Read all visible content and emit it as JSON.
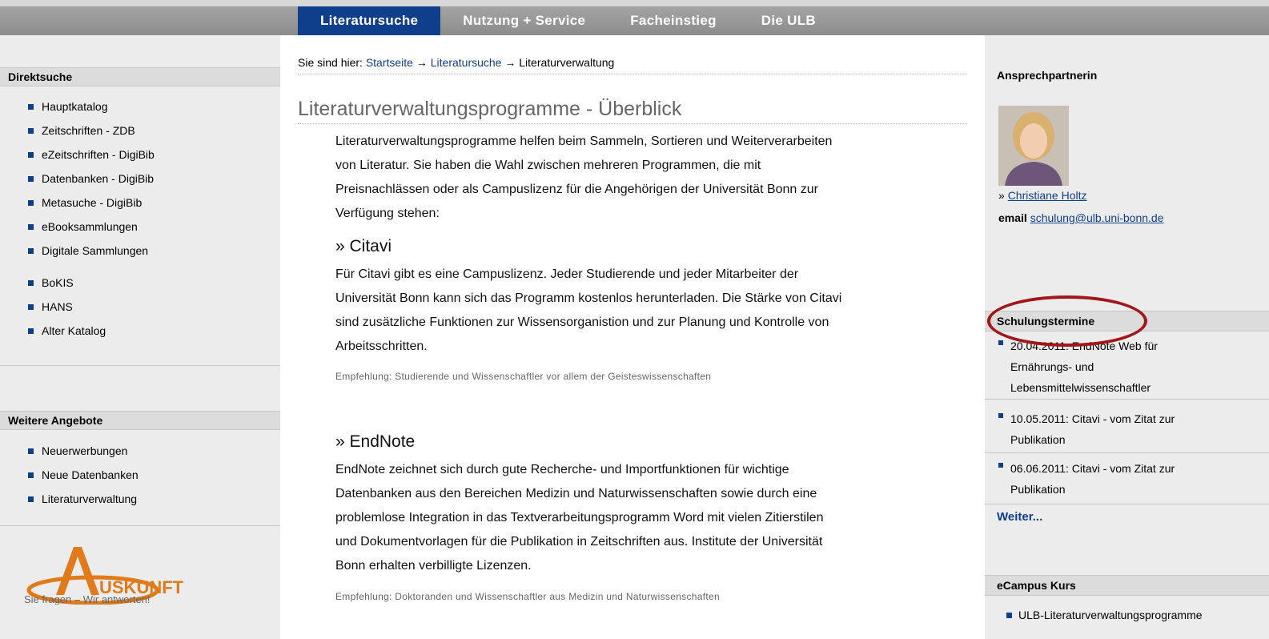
{
  "nav": {
    "items": [
      "Literatursuche",
      "Nutzung + Service",
      "Facheinstieg",
      "Die ULB"
    ]
  },
  "left": {
    "direktsuche_title": "Direktsuche",
    "direktsuche_items": [
      "Hauptkatalog",
      "Zeitschriften - ZDB",
      "eZeitschriften - DigiBib",
      "Datenbanken - DigiBib",
      "Metasuche - DigiBib",
      "eBooksammlungen",
      "Digitale Sammlungen"
    ],
    "other_items": [
      "BoKIS",
      "HANS",
      "Alter Katalog"
    ],
    "weitere_title": "Weitere Angebote",
    "weitere_items": [
      "Neuerwerbungen",
      "Neue Datenbanken",
      "Literaturverwaltung"
    ],
    "logo_text": "USKUNFT",
    "logo_tagline": "Sie fragen – Wir antworten!"
  },
  "breadcrumb": {
    "prefix": "Sie sind hier: ",
    "home": "Startseite",
    "arrow1": " → ",
    "section": "Literatursuche",
    "arrow2": " → ",
    "current": "Literaturverwaltung"
  },
  "main": {
    "title": "Literaturverwaltungsprogramme - Überblick",
    "intro": [
      "Literaturverwaltungsprogramme helfen beim Sammeln, Sortieren und Weiterverarbeiten",
      "von Literatur.  Sie haben die Wahl zwischen mehreren Programmen, die mit",
      "Preisnachlässen oder als Campuslizenz für die Angehörigen der Universität Bonn zur",
      "Verfügung stehen:"
    ],
    "citavi_heading": "» Citavi",
    "citavi_text": [
      "Für Citavi gibt es eine Campuslizenz. Jeder Studierende und jeder Mitarbeiter der",
      "Universität Bonn kann sich das Programm kostenlos herunterladen. Die Stärke von Citavi",
      "sind zusätzliche Funktionen zur Wissensorganistion und zur Planung und Kontrolle von",
      "Arbeitsschritten."
    ],
    "citavi_recommend": "Empfehlung: Studierende und Wissenschaftler vor allem der Geisteswissenschaften",
    "endnote_heading": "» EndNote",
    "endnote_text": [
      "EndNote zeichnet sich durch gute Recherche- und Importfunktionen für wichtige",
      "Datenbanken aus den Bereichen Medizin und Naturwissenschaften sowie durch eine",
      "problemlose Integration in das Textverarbeitungsprogramm Word mit vielen Zitierstilen",
      "und Dokumentvorlagen für die Publikation in Zeitschriften aus. Institute der Universität",
      "Bonn erhalten verbilligte Lizenzen."
    ],
    "endnote_recommend": "Empfehlung: Doktoranden und Wissenschaftler aus Medizin und Naturwissenschaften"
  },
  "right": {
    "contact_title": "Ansprechpartnerin",
    "contact_prefix": "» ",
    "contact_name": "Christiane Holtz",
    "email_label": "email ",
    "email_value": "schulung@ulb.uni-bonn.de",
    "schulung_title": "Schulungstermine",
    "terms": [
      [
        "20.04.2011: EndNote Web für",
        "Ernährungs- und",
        "Lebensmittelwissenschaftler"
      ],
      [
        "10.05.2011: Citavi - vom Zitat zur",
        "Publikation"
      ],
      [
        "06.06.2011: Citavi - vom Zitat zur",
        "Publikation"
      ]
    ],
    "weiter": "Weiter...",
    "ecampus_title": "eCampus Kurs",
    "ecampus_item": "ULB-Literaturverwaltungsprogramme"
  },
  "colors": {
    "nav_active": "#0f3e8a",
    "link": "#0f3e8a",
    "highlight_circle": "#a0161a"
  }
}
